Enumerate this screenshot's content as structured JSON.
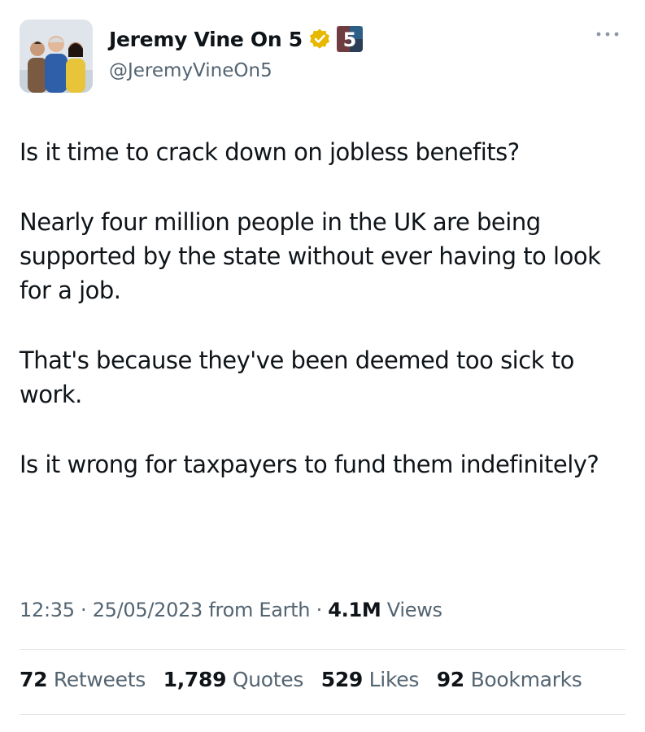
{
  "author": {
    "display_name": "Jeremy Vine On 5",
    "handle": "@JeremyVineOn5",
    "brand_badge": "5",
    "verified_color": "#e8b800",
    "avatar_icon": "presenters-photo"
  },
  "tweet": {
    "paragraphs": [
      "Is it time to crack down on jobless benefits?",
      "Nearly four million people in the UK are being supported by the state without ever having to look for a job.",
      "That's because they've been deemed too sick to work.",
      "Is it wrong for taxpayers to fund them indefinitely?"
    ]
  },
  "meta": {
    "time": "12:35",
    "date": "25/05/2023",
    "source": "from Earth",
    "views_count": "4.1M",
    "views_label": "Views"
  },
  "stats": {
    "retweets_count": "72",
    "retweets_label": "Retweets",
    "quotes_count": "1,789",
    "quotes_label": "Quotes",
    "likes_count": "529",
    "likes_label": "Likes",
    "bookmarks_count": "92",
    "bookmarks_label": "Bookmarks"
  }
}
